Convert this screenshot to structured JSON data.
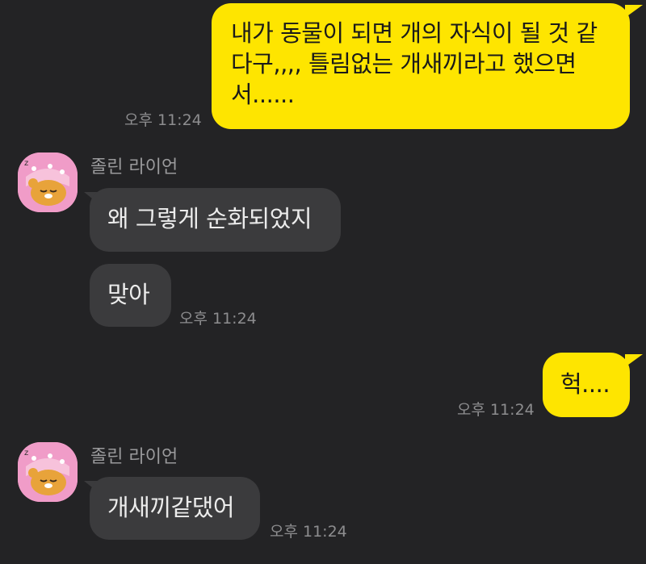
{
  "chat": {
    "messages": [
      {
        "direction": "outgoing",
        "text": "내가 동물이 되면 개의 자식이 될 것 같다구,,,, 틀림없는 개새끼라고 했으면서......",
        "time": "오후 11:24"
      },
      {
        "direction": "incoming",
        "sender": "졸린 라이언",
        "text": "왜 그렇게 순화되었지"
      },
      {
        "direction": "incoming",
        "text": "맞아",
        "time": "오후 11:24"
      },
      {
        "direction": "outgoing",
        "text": "헉....",
        "time": "오후 11:24"
      },
      {
        "direction": "incoming",
        "sender": "졸린 라이언",
        "text": "개새끼같댔어",
        "time": "오후 11:24"
      }
    ]
  },
  "colors": {
    "background": "#232325",
    "outgoing_bubble": "#FEE500",
    "incoming_bubble": "#3B3B3D",
    "timestamp": "#8D8D8F",
    "avatar_bg": "#F09CC8"
  },
  "icons": {
    "avatar": "sleepy-ryan-character-icon"
  }
}
